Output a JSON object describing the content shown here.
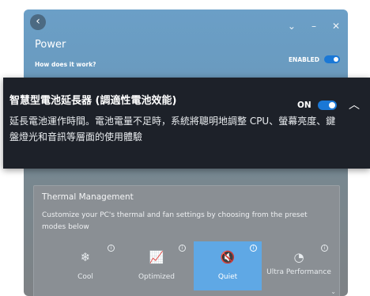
{
  "app": {
    "back_glyph": "‹",
    "title": "Power",
    "how_link": "How does it work?",
    "enabled_label": "ENABLED",
    "window_controls": [
      "⌄",
      "–",
      "✕"
    ]
  },
  "callout": {
    "title": "智慧型電池延長器 (調適性電池效能)",
    "description": "延長電池運作時間。電池電量不足時，系統將聰明地調整 CPU、螢幕亮度、鍵盤燈光和音訊等層面的使用體驗",
    "toggle_label": "ON",
    "toggle_on": true,
    "collapse_glyph": "︿"
  },
  "thermal": {
    "title": "Thermal Management",
    "description": "Customize your PC's thermal and fan settings by choosing from the preset modes below",
    "modes": [
      {
        "label": "Cool",
        "icon": "snowflake-icon",
        "glyph": "❄",
        "selected": false
      },
      {
        "label": "Optimized",
        "icon": "chart-icon",
        "glyph": "📈",
        "selected": false
      },
      {
        "label": "Quiet",
        "icon": "mute-icon",
        "glyph": "🔇",
        "selected": true
      },
      {
        "label": "Ultra Performance",
        "icon": "gauge-icon",
        "glyph": "◔",
        "selected": false
      }
    ],
    "info_glyph": "i",
    "scroll_glyph": "⌄"
  },
  "colors": {
    "accent": "#1a78d6",
    "callout_bg": "#1d2129",
    "selected_mode": "#5fa8e5"
  }
}
